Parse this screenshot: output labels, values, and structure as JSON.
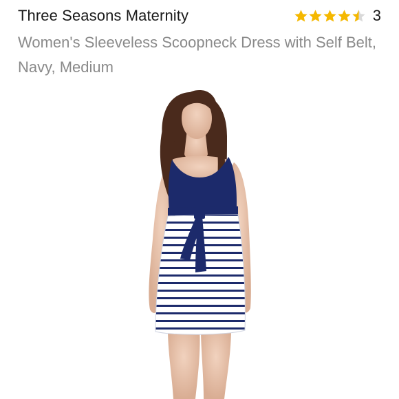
{
  "listing": {
    "brand": "Three Seasons Maternity",
    "title": "Women's Sleeveless Scoopneck Dress with Self Belt, Navy, Medium",
    "rating": {
      "stars": 4.5,
      "max_stars": 5,
      "review_count": "3",
      "star_color": "#f5b800",
      "empty_star_color": "#d9d9d9"
    },
    "image": {
      "subject": "model wearing navy-top, white-and-navy striped sleeveless maternity dress with tie belt",
      "dress_top_color": "#1c2a6b",
      "stripe_color": "#1c2a6b",
      "background_color": "#ffffff"
    }
  }
}
